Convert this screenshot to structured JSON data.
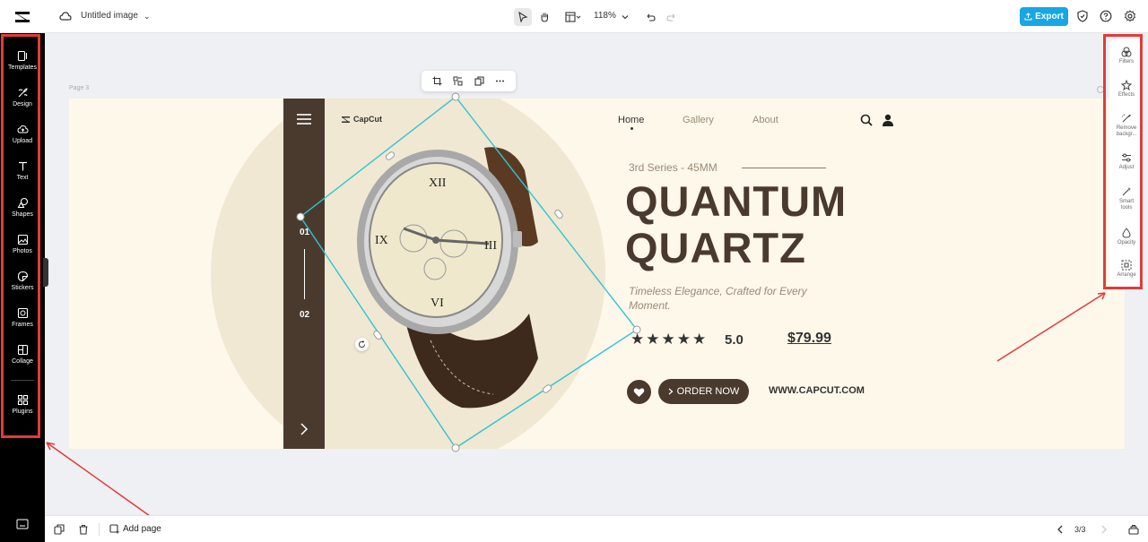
{
  "topbar": {
    "title": "Untitled image",
    "zoom": "118%",
    "export_label": "Export"
  },
  "sidebar": {
    "items": [
      {
        "label": "Templates",
        "icon": "templates-icon"
      },
      {
        "label": "Design",
        "icon": "design-icon"
      },
      {
        "label": "Upload",
        "icon": "upload-icon"
      },
      {
        "label": "Text",
        "icon": "text-icon"
      },
      {
        "label": "Shapes",
        "icon": "shapes-icon"
      },
      {
        "label": "Photos",
        "icon": "photos-icon"
      },
      {
        "label": "Stickers",
        "icon": "stickers-icon"
      },
      {
        "label": "Frames",
        "icon": "frames-icon"
      },
      {
        "label": "Collage",
        "icon": "collage-icon"
      },
      {
        "label": "Plugins",
        "icon": "plugins-icon"
      }
    ]
  },
  "right_panel": {
    "items": [
      {
        "label": "Filters",
        "icon": "filters-icon"
      },
      {
        "label": "Effects",
        "icon": "effects-icon"
      },
      {
        "label": "Remove backgr...",
        "icon": "remove-background-icon"
      },
      {
        "label": "Adjust",
        "icon": "adjust-icon"
      },
      {
        "label": "Smart tools",
        "icon": "smart-tools-icon"
      },
      {
        "label": "Opacity",
        "icon": "opacity-icon"
      },
      {
        "label": "Arrange",
        "icon": "arrange-icon"
      }
    ]
  },
  "canvas": {
    "page_label": "Page 3",
    "brand": "CapCut",
    "nav": [
      "Home",
      "Gallery",
      "About"
    ],
    "strip_numbers": [
      "01",
      "02"
    ],
    "series": "3rd Series - 45MM",
    "title_line1": "QUANTUM",
    "title_line2": "QUARTZ",
    "tagline": "Timeless Elegance, Crafted for Every Moment.",
    "stars": "★★★★★",
    "rating": "5.0",
    "price": "$79.99",
    "order_label": "ORDER NOW",
    "url": "WWW.CAPCUT.COM",
    "colors": {
      "dark_brown": "#4a3a2e",
      "cream": "#fdf8ea",
      "selection": "#2fc4d8"
    }
  },
  "bottombar": {
    "add_page": "Add page",
    "page_indicator": "3/3"
  },
  "colors": {
    "accent": "#17a6e6",
    "annotation": "#e43a3a"
  }
}
